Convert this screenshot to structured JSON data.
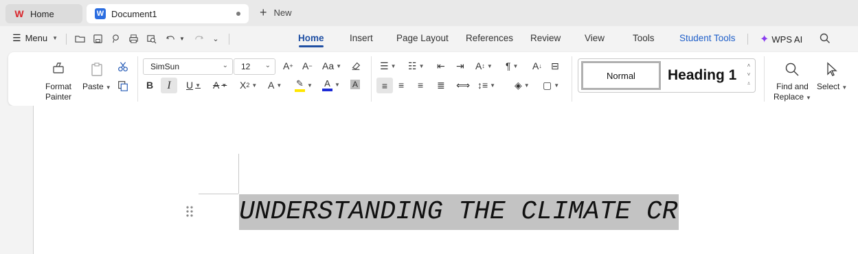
{
  "tabs": {
    "home_label": "Home",
    "doc_label": "Document1",
    "doc_icon_letter": "W",
    "new_label": "New"
  },
  "menu": {
    "label": "Menu",
    "nav": [
      "Home",
      "Insert",
      "Page Layout",
      "References",
      "Review",
      "View",
      "Tools",
      "Student Tools"
    ],
    "wps_ai": "WPS AI"
  },
  "ribbon": {
    "format_painter": "Format Painter",
    "format_painter_line1": "Format",
    "format_painter_line2": "Painter",
    "paste": "Paste",
    "font_name": "SimSun",
    "font_size": "12",
    "style_normal": "Normal",
    "style_heading1": "Heading 1",
    "find_replace_line1": "Find and",
    "find_replace_line2": "Replace",
    "select": "Select"
  },
  "document": {
    "heading": "UNDERSTANDING THE CLIMATE CRISIS"
  },
  "colors": {
    "accent": "#1f4fa3",
    "highlight": "#ffe600",
    "font_color": "#1d2bd6",
    "selection": "#c3c3c3"
  }
}
